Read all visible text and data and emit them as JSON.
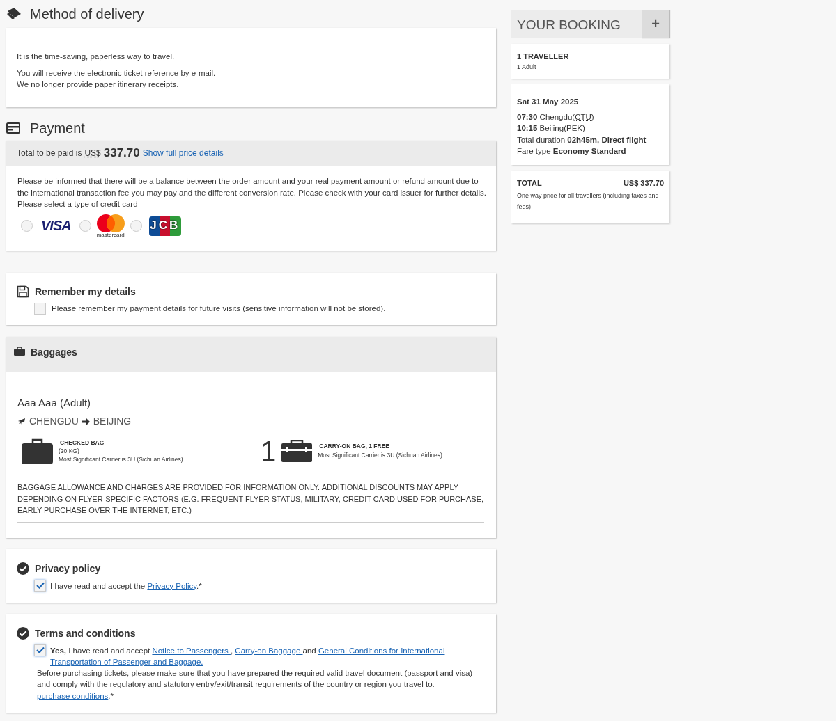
{
  "delivery": {
    "title": "Method of delivery",
    "lines": [
      "It is the time-saving, paperless way to travel.",
      "You will receive the electronic ticket reference by e-mail.",
      "We no longer provide paper itinerary receipts."
    ]
  },
  "payment": {
    "title": "Payment",
    "total_label": "Total to be paid is",
    "currency": "US$",
    "amount": "337.70",
    "details_link": "Show full price details",
    "notice": "Please be informed that there will be a balance between the order amount and your real payment amount or refund amount due to the international transaction fee you may pay and the different conversion rate. Please check with your card issuer for further details.",
    "select_label": "Please select a type of credit card",
    "cards": [
      {
        "kind": "visa",
        "label": "VISA",
        "selected": false
      },
      {
        "kind": "mastercard",
        "label": "mastercard",
        "selected": false
      },
      {
        "kind": "jcb",
        "label": "JCB",
        "selected": false
      }
    ]
  },
  "remember": {
    "title": "Remember my details",
    "label": "Please remember my payment details for future visits (sensitive information will not be stored).",
    "checked": false
  },
  "baggages": {
    "title": "Baggages",
    "passenger": "Aaa Aaa (Adult)",
    "from": "CHENGDU",
    "to": "BEIJING",
    "bags": [
      {
        "kind": "checked",
        "title": "CHECKED BAG",
        "weight": "(20 KG)",
        "carrier": "Most Significant Carrier is 3U (Sichuan Airlines)"
      },
      {
        "kind": "carry_on",
        "count": "1",
        "title": "CARRY-ON BAG, 1 FREE",
        "carrier": "Most Significant Carrier is 3U (Sichuan Airlines)"
      }
    ],
    "disclaimer": "BAGGAGE ALLOWANCE AND CHARGES ARE PROVIDED FOR INFORMATION ONLY. ADDITIONAL DISCOUNTS MAY APPLY DEPENDING ON FLYER-SPECIFIC FACTORS (E.G. FREQUENT FLYER STATUS, MILITARY, CREDIT CARD USED FOR PURCHASE, EARLY PURCHASE OVER THE INTERNET, ETC.)"
  },
  "privacy": {
    "title": "Privacy policy",
    "checked": true,
    "segments": [
      {
        "kind": "text",
        "text": "I have read and accept the "
      },
      {
        "kind": "link",
        "text": "Privacy Policy"
      },
      {
        "kind": "text",
        "text": ".*"
      }
    ]
  },
  "terms": {
    "title": "Terms and conditions",
    "checked": true,
    "segments": [
      {
        "kind": "bold",
        "text": "Yes,"
      },
      {
        "kind": "text",
        "text": " I have read and accept "
      },
      {
        "kind": "link",
        "text": "Notice to Passengers "
      },
      {
        "kind": "text",
        "text": ", "
      },
      {
        "kind": "link",
        "text": "Carry-on Baggage "
      },
      {
        "kind": "text",
        "text": "and "
      },
      {
        "kind": "link",
        "text": "General Conditions for International"
      },
      {
        "kind": "break"
      },
      {
        "kind": "link",
        "text": "Transportation of Passenger and Baggage. "
      }
    ],
    "notice_segments": [
      {
        "kind": "text",
        "text": "Before purchasing tickets, please make sure that you have prepared the required valid travel document (passport and visa) and comply with the regulatory and statutory entry/exit/transit requirements of the country or region you travel to."
      },
      {
        "kind": "break"
      },
      {
        "kind": "link",
        "text": "purchase conditions"
      },
      {
        "kind": "text",
        "text": ".*"
      }
    ]
  },
  "booking": {
    "title": "YOUR BOOKING",
    "expand": "+",
    "travellers": "1 TRAVELLER",
    "travellers_detail": "1 Adult",
    "date": "Sat 31 May 2025",
    "legs": [
      {
        "time": "07:30",
        "place": "Chengdu(",
        "code": "CTU",
        "close": ")"
      },
      {
        "time": "10:15",
        "place": "Beijing(",
        "code": "PEK",
        "close": ")"
      }
    ],
    "duration": "Total duration **02h45m, Direct flight**",
    "fare": "Fare type **Economy Standard**",
    "total_label": "TOTAL",
    "currency": "US$",
    "amount": "337.70",
    "total_note": "One way price for all travellers (including taxes and fees)"
  }
}
